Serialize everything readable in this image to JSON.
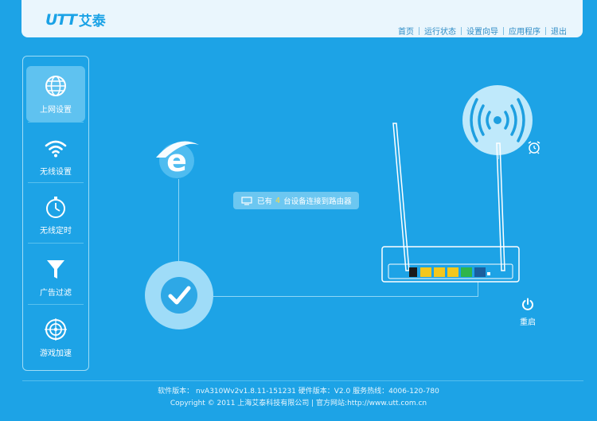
{
  "brand": {
    "logo_text": "UTT",
    "name_cn": "艾泰"
  },
  "nav": [
    "首页",
    "运行状态",
    "设置向导",
    "应用程序",
    "退出"
  ],
  "sidebar": {
    "items": [
      {
        "label": "上网设置",
        "icon": "globe-icon",
        "active": true
      },
      {
        "label": "无线设置",
        "icon": "wifi-icon",
        "active": false
      },
      {
        "label": "无线定时",
        "icon": "stopwatch-icon",
        "active": false
      },
      {
        "label": "广告过滤",
        "icon": "filter-icon",
        "active": false
      },
      {
        "label": "游戏加速",
        "icon": "target-icon",
        "active": false
      }
    ]
  },
  "main": {
    "devices": {
      "prefix": "已有",
      "count": "4",
      "suffix": "台设备连接到路由器"
    },
    "restart_label": "重启"
  },
  "footer": {
    "line1": "软件版本： nvA310Wv2v1.8.11-151231   硬件版本：V2.0    服务热线：4006-120-780",
    "line2": "Copyright © 2011 上海艾泰科技有限公司  |  官方网站:http://www.utt.com.cn"
  },
  "colors": {
    "background": "#1da3e6",
    "header_bg": "#eaf6fd",
    "accent": "#1aa2e6",
    "highlight": "#ffd83a"
  }
}
